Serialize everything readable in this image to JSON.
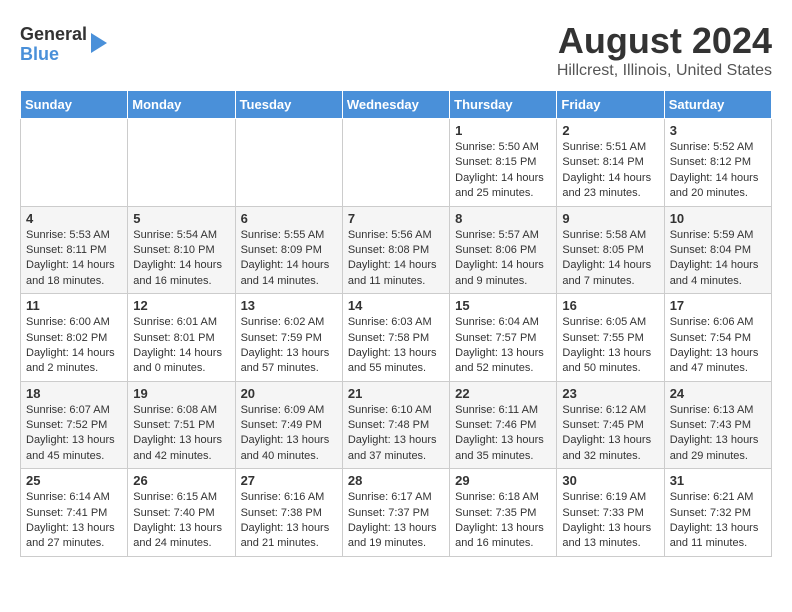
{
  "logo": {
    "line1": "General",
    "line2": "Blue"
  },
  "title": "August 2024",
  "subtitle": "Hillcrest, Illinois, United States",
  "days_of_week": [
    "Sunday",
    "Monday",
    "Tuesday",
    "Wednesday",
    "Thursday",
    "Friday",
    "Saturday"
  ],
  "weeks": [
    [
      {
        "day": "",
        "detail": ""
      },
      {
        "day": "",
        "detail": ""
      },
      {
        "day": "",
        "detail": ""
      },
      {
        "day": "",
        "detail": ""
      },
      {
        "day": "1",
        "detail": "Sunrise: 5:50 AM\nSunset: 8:15 PM\nDaylight: 14 hours\nand 25 minutes."
      },
      {
        "day": "2",
        "detail": "Sunrise: 5:51 AM\nSunset: 8:14 PM\nDaylight: 14 hours\nand 23 minutes."
      },
      {
        "day": "3",
        "detail": "Sunrise: 5:52 AM\nSunset: 8:12 PM\nDaylight: 14 hours\nand 20 minutes."
      }
    ],
    [
      {
        "day": "4",
        "detail": "Sunrise: 5:53 AM\nSunset: 8:11 PM\nDaylight: 14 hours\nand 18 minutes."
      },
      {
        "day": "5",
        "detail": "Sunrise: 5:54 AM\nSunset: 8:10 PM\nDaylight: 14 hours\nand 16 minutes."
      },
      {
        "day": "6",
        "detail": "Sunrise: 5:55 AM\nSunset: 8:09 PM\nDaylight: 14 hours\nand 14 minutes."
      },
      {
        "day": "7",
        "detail": "Sunrise: 5:56 AM\nSunset: 8:08 PM\nDaylight: 14 hours\nand 11 minutes."
      },
      {
        "day": "8",
        "detail": "Sunrise: 5:57 AM\nSunset: 8:06 PM\nDaylight: 14 hours\nand 9 minutes."
      },
      {
        "day": "9",
        "detail": "Sunrise: 5:58 AM\nSunset: 8:05 PM\nDaylight: 14 hours\nand 7 minutes."
      },
      {
        "day": "10",
        "detail": "Sunrise: 5:59 AM\nSunset: 8:04 PM\nDaylight: 14 hours\nand 4 minutes."
      }
    ],
    [
      {
        "day": "11",
        "detail": "Sunrise: 6:00 AM\nSunset: 8:02 PM\nDaylight: 14 hours\nand 2 minutes."
      },
      {
        "day": "12",
        "detail": "Sunrise: 6:01 AM\nSunset: 8:01 PM\nDaylight: 14 hours\nand 0 minutes."
      },
      {
        "day": "13",
        "detail": "Sunrise: 6:02 AM\nSunset: 7:59 PM\nDaylight: 13 hours\nand 57 minutes."
      },
      {
        "day": "14",
        "detail": "Sunrise: 6:03 AM\nSunset: 7:58 PM\nDaylight: 13 hours\nand 55 minutes."
      },
      {
        "day": "15",
        "detail": "Sunrise: 6:04 AM\nSunset: 7:57 PM\nDaylight: 13 hours\nand 52 minutes."
      },
      {
        "day": "16",
        "detail": "Sunrise: 6:05 AM\nSunset: 7:55 PM\nDaylight: 13 hours\nand 50 minutes."
      },
      {
        "day": "17",
        "detail": "Sunrise: 6:06 AM\nSunset: 7:54 PM\nDaylight: 13 hours\nand 47 minutes."
      }
    ],
    [
      {
        "day": "18",
        "detail": "Sunrise: 6:07 AM\nSunset: 7:52 PM\nDaylight: 13 hours\nand 45 minutes."
      },
      {
        "day": "19",
        "detail": "Sunrise: 6:08 AM\nSunset: 7:51 PM\nDaylight: 13 hours\nand 42 minutes."
      },
      {
        "day": "20",
        "detail": "Sunrise: 6:09 AM\nSunset: 7:49 PM\nDaylight: 13 hours\nand 40 minutes."
      },
      {
        "day": "21",
        "detail": "Sunrise: 6:10 AM\nSunset: 7:48 PM\nDaylight: 13 hours\nand 37 minutes."
      },
      {
        "day": "22",
        "detail": "Sunrise: 6:11 AM\nSunset: 7:46 PM\nDaylight: 13 hours\nand 35 minutes."
      },
      {
        "day": "23",
        "detail": "Sunrise: 6:12 AM\nSunset: 7:45 PM\nDaylight: 13 hours\nand 32 minutes."
      },
      {
        "day": "24",
        "detail": "Sunrise: 6:13 AM\nSunset: 7:43 PM\nDaylight: 13 hours\nand 29 minutes."
      }
    ],
    [
      {
        "day": "25",
        "detail": "Sunrise: 6:14 AM\nSunset: 7:41 PM\nDaylight: 13 hours\nand 27 minutes."
      },
      {
        "day": "26",
        "detail": "Sunrise: 6:15 AM\nSunset: 7:40 PM\nDaylight: 13 hours\nand 24 minutes."
      },
      {
        "day": "27",
        "detail": "Sunrise: 6:16 AM\nSunset: 7:38 PM\nDaylight: 13 hours\nand 21 minutes."
      },
      {
        "day": "28",
        "detail": "Sunrise: 6:17 AM\nSunset: 7:37 PM\nDaylight: 13 hours\nand 19 minutes."
      },
      {
        "day": "29",
        "detail": "Sunrise: 6:18 AM\nSunset: 7:35 PM\nDaylight: 13 hours\nand 16 minutes."
      },
      {
        "day": "30",
        "detail": "Sunrise: 6:19 AM\nSunset: 7:33 PM\nDaylight: 13 hours\nand 13 minutes."
      },
      {
        "day": "31",
        "detail": "Sunrise: 6:21 AM\nSunset: 7:32 PM\nDaylight: 13 hours\nand 11 minutes."
      }
    ]
  ]
}
